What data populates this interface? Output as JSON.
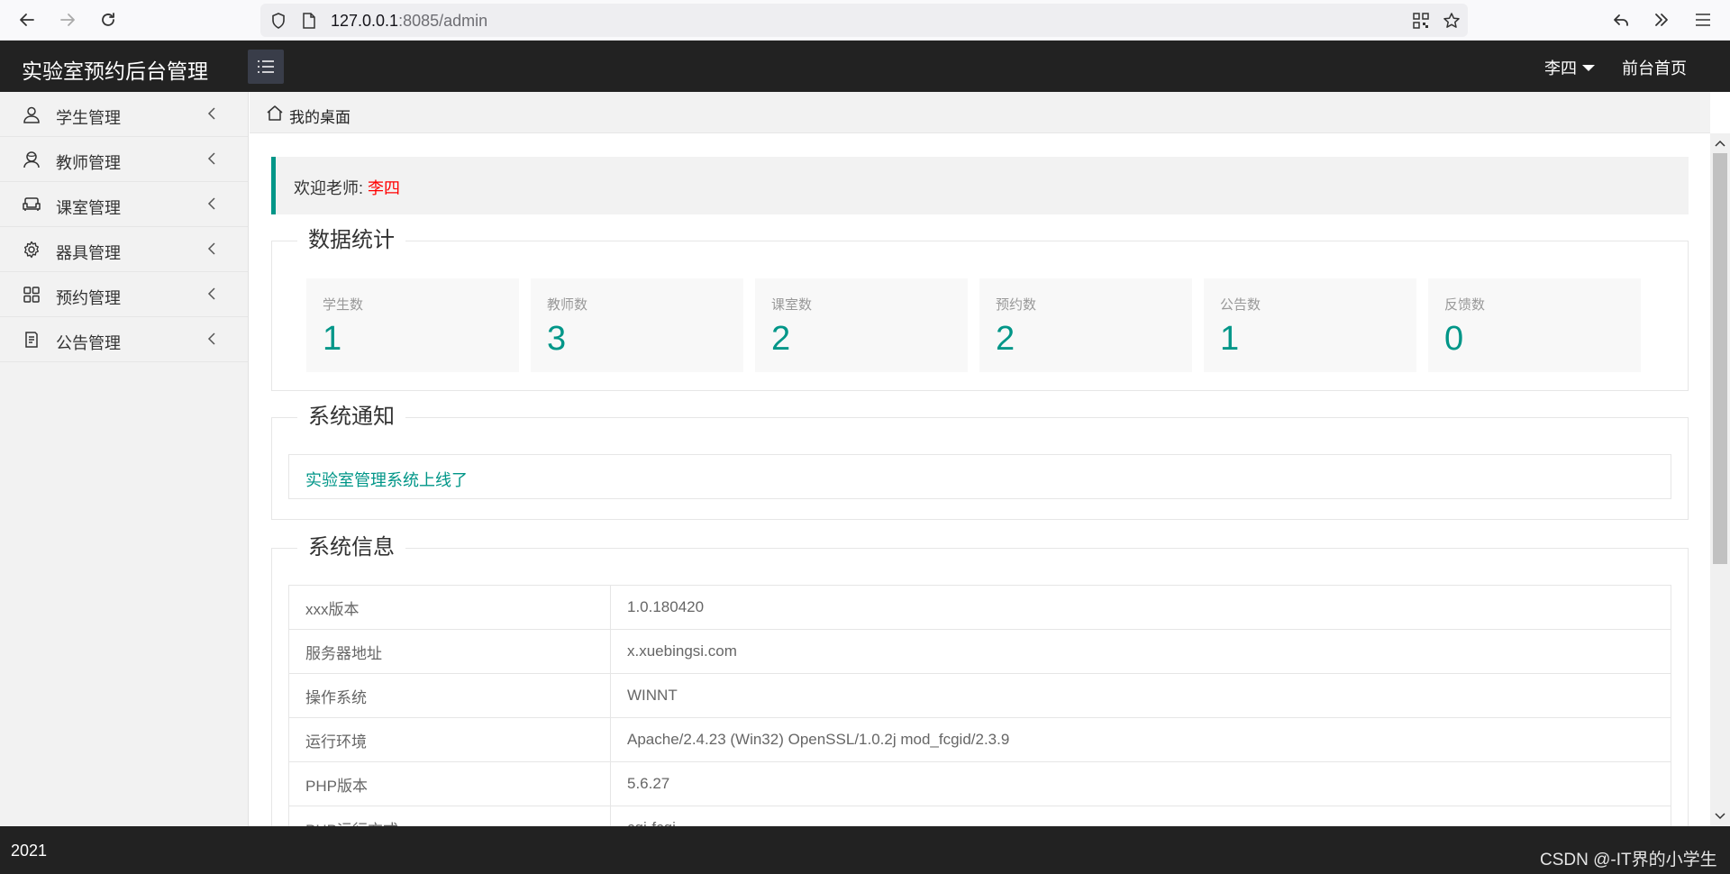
{
  "browser": {
    "url_host": "127.0.0.1",
    "url_rest": ":8085/admin"
  },
  "header": {
    "title": "实验室预约后台管理",
    "user_name": "李四",
    "front_link": "前台首页"
  },
  "sidebar": {
    "items": [
      {
        "label": "学生管理",
        "icon": "user-icon"
      },
      {
        "label": "教师管理",
        "icon": "teacher-icon"
      },
      {
        "label": "课室管理",
        "icon": "sofa-icon"
      },
      {
        "label": "器具管理",
        "icon": "gear-icon"
      },
      {
        "label": "预约管理",
        "icon": "grid-icon"
      },
      {
        "label": "公告管理",
        "icon": "note-icon"
      }
    ]
  },
  "breadcrumb": {
    "label": "我的桌面"
  },
  "welcome": {
    "prefix": "欢迎老师: ",
    "name": "李四",
    "accent_color": "#009688",
    "name_color": "#ff0000"
  },
  "stats": {
    "legend": "数据统计",
    "items": [
      {
        "label": "学生数",
        "value": "1"
      },
      {
        "label": "教师数",
        "value": "3"
      },
      {
        "label": "课室数",
        "value": "2"
      },
      {
        "label": "预约数",
        "value": "2"
      },
      {
        "label": "公告数",
        "value": "1"
      },
      {
        "label": "反馈数",
        "value": "0"
      }
    ]
  },
  "notice": {
    "legend": "系统通知",
    "text": "实验室管理系统上线了"
  },
  "sysinfo": {
    "legend": "系统信息",
    "rows": [
      {
        "key": "xxx版本",
        "value": "1.0.180420"
      },
      {
        "key": "服务器地址",
        "value": "x.xuebingsi.com"
      },
      {
        "key": "操作系统",
        "value": "WINNT"
      },
      {
        "key": "运行环境",
        "value": "Apache/2.4.23 (Win32) OpenSSL/1.0.2j mod_fcgid/2.3.9"
      },
      {
        "key": "PHP版本",
        "value": "5.6.27"
      },
      {
        "key": "PHP运行方式",
        "value": "cgi-fcgi"
      }
    ]
  },
  "footer": {
    "year": "2021",
    "watermark": "CSDN @-IT界的小学生"
  }
}
